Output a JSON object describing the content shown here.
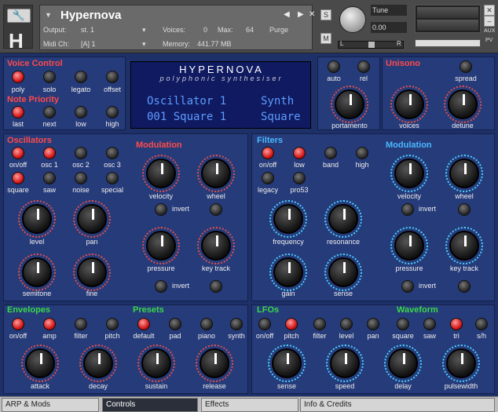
{
  "header": {
    "instrument_name": "Hypernova",
    "output_label": "Output:",
    "output_value": "st. 1",
    "voices_label": "Voices:",
    "voices_value": "0",
    "max_label": "Max:",
    "max_value": "64",
    "purge_label": "Purge",
    "midi_label": "Midi Ch:",
    "midi_value": "[A] 1",
    "memory_label": "Memory:",
    "memory_value": "441.77 MB",
    "s_label": "S",
    "m_label": "M",
    "tune_label": "Tune",
    "tune_value": "0.00",
    "aux_label": "AUX",
    "pv_label": "PV",
    "l_label": "L",
    "r_label": "R"
  },
  "voice_control": {
    "title": "Voice Control",
    "buttons": [
      "poly",
      "solo",
      "legato",
      "offset"
    ]
  },
  "note_priority": {
    "title": "Note Priority",
    "buttons": [
      "last",
      "next",
      "low",
      "high"
    ]
  },
  "display": {
    "brand": "HYPERNOVA",
    "subtitle": "polyphonic synthesiser",
    "line1_left": "Oscillator 1",
    "line1_right": "Synth",
    "line2_left": "001 Square 1",
    "line2_right": "Square"
  },
  "top_right": {
    "buttons": [
      "auto",
      "rel"
    ],
    "knob": "portamento"
  },
  "unisono": {
    "title": "Unisono",
    "button": "spread",
    "knobs": [
      "voices",
      "detune"
    ]
  },
  "oscillators": {
    "title": "Oscillators",
    "row1": [
      "on/off",
      "osc 1",
      "osc 2",
      "osc 3"
    ],
    "row2": [
      "square",
      "saw",
      "noise",
      "special"
    ],
    "knobs": [
      "level",
      "pan",
      "semitone",
      "fine"
    ]
  },
  "osc_modulation": {
    "title": "Modulation",
    "knobs": [
      "velocity",
      "wheel",
      "pressure",
      "key track"
    ],
    "invert": "invert"
  },
  "filters": {
    "title": "Filters",
    "row1": [
      "on/off",
      "low",
      "band",
      "high"
    ],
    "row2": [
      "legacy",
      "pro53"
    ],
    "knobs": [
      "frequency",
      "resonance",
      "gain",
      "sense"
    ]
  },
  "filter_modulation": {
    "title": "Modulation",
    "knobs": [
      "velocity",
      "wheel",
      "pressure",
      "key track"
    ],
    "invert": "invert"
  },
  "envelopes": {
    "title": "Envelopes",
    "buttons": [
      "on/off",
      "amp",
      "filter",
      "pitch"
    ],
    "knobs": [
      "attack",
      "decay",
      "sustain",
      "release"
    ]
  },
  "presets": {
    "title": "Presets",
    "buttons": [
      "default",
      "pad",
      "piano",
      "synth"
    ]
  },
  "lfos": {
    "title": "LFOs",
    "buttons": [
      "on/off",
      "pitch",
      "filter",
      "level",
      "pan"
    ],
    "knobs": [
      "sense",
      "speed",
      "delay",
      "pulsewidth"
    ]
  },
  "waveform": {
    "title": "Waveform",
    "buttons": [
      "square",
      "saw",
      "tri",
      "s/h"
    ]
  },
  "tabs": [
    "ARP & Mods",
    "Controls",
    "Effects",
    "Info & Credits"
  ]
}
